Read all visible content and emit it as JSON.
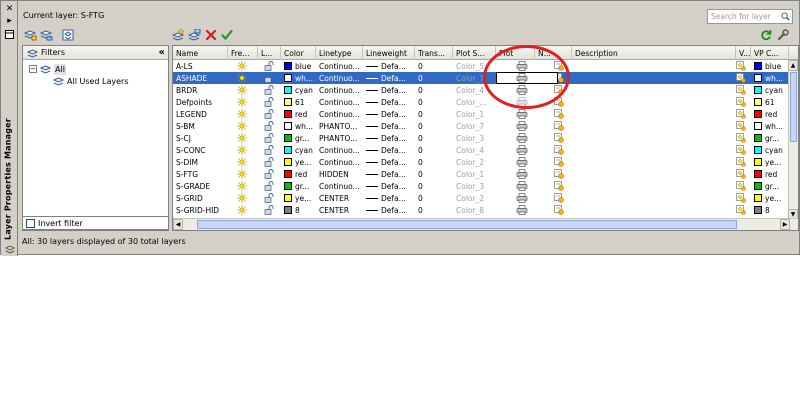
{
  "window": {
    "side_title": "Layer Properties Manager",
    "current_layer": "Current layer: S-FTG",
    "search_placeholder": "Search for layer",
    "status": "All: 30 layers displayed of 30 total layers"
  },
  "filters": {
    "header": "Filters",
    "tree": [
      {
        "label": "All",
        "level": 0
      },
      {
        "label": "All Used Layers",
        "level": 1
      }
    ],
    "invert_label": "Invert filter"
  },
  "columns": [
    "Name",
    "Fre...",
    "L...",
    "Color",
    "Linetype",
    "Lineweight",
    "Trans...",
    "Plot S...",
    "Plot",
    "N...",
    "Description",
    "V...",
    "VP C..."
  ],
  "rows": [
    {
      "name": "A-LS",
      "color_name": "blue",
      "color_hex": "#0000ff",
      "linetype": "Continuo...",
      "lineweight": "Defa...",
      "trans": "0",
      "plot_style": "Color_5",
      "vp_color": "blue",
      "selected": false
    },
    {
      "name": "ASHADE",
      "color_name": "wh...",
      "color_hex": "#ffffff",
      "linetype": "Continuo...",
      "lineweight": "Defa...",
      "trans": "0",
      "plot_style": "Color_7",
      "vp_color": "wh...",
      "selected": true
    },
    {
      "name": "BRDR",
      "color_name": "cyan",
      "color_hex": "#00ffff",
      "linetype": "Continuo...",
      "lineweight": "Defa...",
      "trans": "0",
      "plot_style": "Color_4",
      "vp_color": "cyan",
      "selected": false
    },
    {
      "name": "Defpoints",
      "color_name": "61",
      "color_hex": "#ffff7f",
      "linetype": "Continuo...",
      "lineweight": "Defa...",
      "trans": "0",
      "plot_style": "Color_...",
      "vp_color": "61",
      "selected": false
    },
    {
      "name": "LEGEND",
      "color_name": "red",
      "color_hex": "#ff0000",
      "linetype": "Continuo...",
      "lineweight": "Defa...",
      "trans": "0",
      "plot_style": "Color_1",
      "vp_color": "red",
      "selected": false
    },
    {
      "name": "S-BM",
      "color_name": "wh...",
      "color_hex": "#ffffff",
      "linetype": "PHANTO...",
      "lineweight": "Defa...",
      "trans": "0",
      "plot_style": "Color_7",
      "vp_color": "wh...",
      "selected": false
    },
    {
      "name": "S-CJ",
      "color_name": "gr...",
      "color_hex": "#00c000",
      "linetype": "PHANTO...",
      "lineweight": "Defa...",
      "trans": "0",
      "plot_style": "Color_3",
      "vp_color": "gr...",
      "selected": false
    },
    {
      "name": "S-CONC",
      "color_name": "cyan",
      "color_hex": "#00ffff",
      "linetype": "Continuo...",
      "lineweight": "Defa...",
      "trans": "0",
      "plot_style": "Color_4",
      "vp_color": "cyan",
      "selected": false
    },
    {
      "name": "S-DIM",
      "color_name": "ye...",
      "color_hex": "#ffff00",
      "linetype": "Continuo...",
      "lineweight": "Defa...",
      "trans": "0",
      "plot_style": "Color_2",
      "vp_color": "ye...",
      "selected": false
    },
    {
      "name": "S-FTG",
      "color_name": "red",
      "color_hex": "#ff0000",
      "linetype": "HIDDEN",
      "lineweight": "Defa...",
      "trans": "0",
      "plot_style": "Color_1",
      "vp_color": "red",
      "selected": false
    },
    {
      "name": "S-GRADE",
      "color_name": "gr...",
      "color_hex": "#00c000",
      "linetype": "Continuo...",
      "lineweight": "Defa...",
      "trans": "0",
      "plot_style": "Color_3",
      "vp_color": "gr...",
      "selected": false
    },
    {
      "name": "S-GRID",
      "color_name": "ye...",
      "color_hex": "#ffff00",
      "linetype": "CENTER",
      "lineweight": "Defa...",
      "trans": "0",
      "plot_style": "Color_2",
      "vp_color": "ye...",
      "selected": false
    },
    {
      "name": "S-GRID-HID",
      "color_name": "8",
      "color_hex": "#808080",
      "linetype": "CENTER",
      "lineweight": "Defa...",
      "trans": "0",
      "plot_style": "Color_8",
      "vp_color": "8",
      "selected": false
    }
  ],
  "colors": {
    "selection": "#316ac5",
    "annotation_circle": "#e31e1e",
    "panel": "#d4d0c8"
  }
}
